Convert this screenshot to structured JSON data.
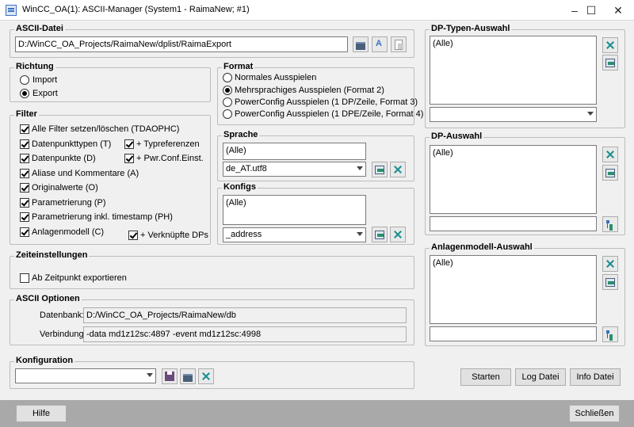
{
  "window": {
    "title": "WinCC_OA(1): ASCII-Manager (System1 - RaimaNew; #1)",
    "minimize": "–",
    "maximize": "☐",
    "close": "✕"
  },
  "ascii_datei": {
    "label": "ASCII-Datei",
    "path": "D:/WinCC_OA_Projects/RaimaNew/dplist/RaimaExport"
  },
  "richtung": {
    "label": "Richtung",
    "options": [
      "Import",
      "Export"
    ],
    "selected": "Export"
  },
  "filter": {
    "label": "Filter",
    "items": [
      {
        "label": "Alle Filter setzen/löschen (TDAOPHC)",
        "checked": true
      },
      {
        "label": "Datenpunkttypen (T)",
        "checked": true
      },
      {
        "label": "+ Typreferenzen",
        "checked": true
      },
      {
        "label": "Datenpunkte (D)",
        "checked": true
      },
      {
        "label": "+ Pwr.Conf.Einst.",
        "checked": true
      },
      {
        "label": "Aliase und Kommentare (A)",
        "checked": true
      },
      {
        "label": "Originalwerte (O)",
        "checked": true
      },
      {
        "label": "Parametrierung (P)",
        "checked": true
      },
      {
        "label": "Parametrierung inkl. timestamp (PH)",
        "checked": true
      },
      {
        "label": "Anlagenmodell  (C)",
        "checked": true
      },
      {
        "label": "+ Verknüpfte DPs",
        "checked": true
      }
    ]
  },
  "format": {
    "label": "Format",
    "options": [
      "Normales Ausspielen",
      "Mehrsprachiges Ausspielen (Format 2)",
      "PowerConfig Ausspielen (1 DP/Zeile, Format 3)",
      "PowerConfig Ausspielen (1 DPE/Zeile, Format 4)"
    ],
    "selected_index": 1
  },
  "sprache": {
    "label": "Sprache",
    "list_item": "(Alle)",
    "combo_value": "de_AT.utf8"
  },
  "konfigs": {
    "label": "Konfigs",
    "list_item": "(Alle)",
    "combo_value": "_address"
  },
  "zeit": {
    "label": "Zeiteinstellungen",
    "checkbox_label": "Ab Zeitpunkt exportieren",
    "checked": false
  },
  "ascii_optionen": {
    "label": "ASCII Optionen",
    "datenbank_label": "Datenbank:",
    "datenbank_value": "D:/WinCC_OA_Projects/RaimaNew/db",
    "verbindung_label": "Verbindung:",
    "verbindung_value": "-data md1z12sc:4897 -event md1z12sc:4998"
  },
  "konfiguration": {
    "label": "Konfiguration",
    "combo_value": ""
  },
  "dp_typen": {
    "label": "DP-Typen-Auswahl",
    "list_item": "(Alle)",
    "combo_value": ""
  },
  "dp_auswahl": {
    "label": "DP-Auswahl",
    "list_item": "(Alle)",
    "field_value": ""
  },
  "anlagen": {
    "label": "Anlagenmodell-Auswahl",
    "list_item": "(Alle)",
    "field_value": ""
  },
  "buttons": {
    "starten": "Starten",
    "log": "Log Datei",
    "info": "Info Datei",
    "hilfe": "Hilfe",
    "schliessen": "Schließen"
  }
}
